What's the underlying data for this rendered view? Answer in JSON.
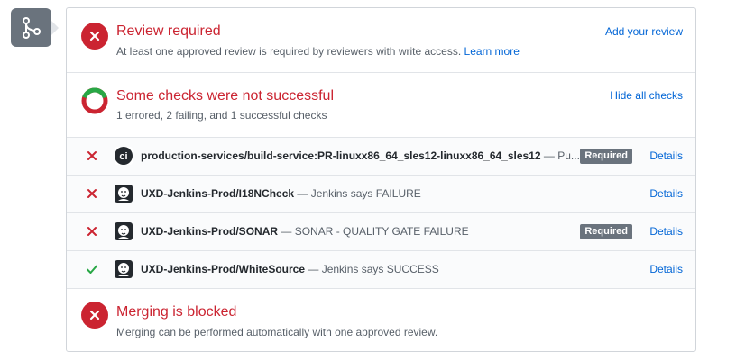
{
  "colors": {
    "danger": "#cb2431",
    "success": "#28a745",
    "link": "#0366d6",
    "muted": "#586069",
    "badge_bg": "#6a737d"
  },
  "review": {
    "title": "Review required",
    "subtitle": "At least one approved review is required by reviewers with write access.",
    "learn_more": "Learn more",
    "action": "Add your review"
  },
  "checks": {
    "title": "Some checks were not successful",
    "summary": "1 errored, 2 failing, and 1 successful checks",
    "action": "Hide all checks",
    "rows": [
      {
        "status": "failure",
        "avatar": "ci-logo-icon",
        "context": "production-services/build-service:PR-linuxx86_64_sles12-linuxx86_64_sles12",
        "description": " — Pu...",
        "required": "Required",
        "details": "Details"
      },
      {
        "status": "failure",
        "avatar": "jenkins-icon",
        "context": "UXD-Jenkins-Prod/I18NCheck",
        "description": " — Jenkins says FAILURE",
        "required": "",
        "details": "Details"
      },
      {
        "status": "failure",
        "avatar": "jenkins-icon",
        "context": "UXD-Jenkins-Prod/SONAR",
        "description": " — SONAR - QUALITY GATE FAILURE",
        "required": "Required",
        "details": "Details"
      },
      {
        "status": "success",
        "avatar": "jenkins-icon",
        "context": "UXD-Jenkins-Prod/WhiteSource",
        "description": " — Jenkins says SUCCESS",
        "required": "",
        "details": "Details"
      }
    ]
  },
  "merge": {
    "title": "Merging is blocked",
    "subtitle": "Merging can be performed automatically with one approved review."
  }
}
